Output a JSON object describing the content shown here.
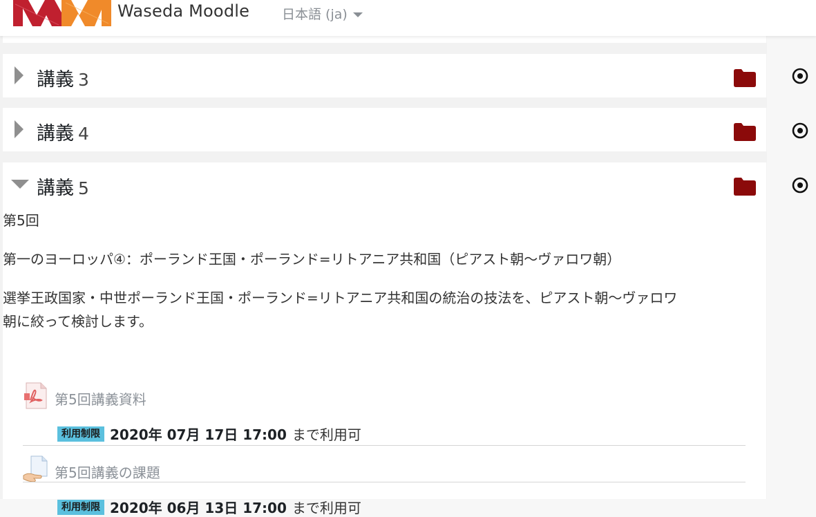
{
  "header": {
    "site_name": "Waseda Moodle",
    "language": "日本語 (ja)",
    "brand_colors": {
      "red": "#c0202f",
      "orange": "#f08a2a"
    }
  },
  "sections": [
    {
      "title": "講義",
      "number": "3",
      "expanded": false
    },
    {
      "title": "講義",
      "number": "4",
      "expanded": false
    },
    {
      "title": "講義",
      "number": "5",
      "expanded": true
    }
  ],
  "section5": {
    "summary": [
      "第5回",
      "第一のヨーロッパ④：ポーランド王国・ポーランド=リトアニア共和国（ピアスト朝〜ヴァロワ朝）",
      "選挙王政国家・中世ポーランド王国・ポーランド=リトアニア共和国の統治の技法を、ピアスト朝〜ヴァロワ",
      "朝に絞って検討します。"
    ],
    "activities": [
      {
        "name": "第5回講義資料",
        "icon": "pdf-icon",
        "restriction_badge": "利用制限",
        "restriction_date": "2020年 07月 17日 17:00",
        "restriction_suffix": "まで利用可"
      },
      {
        "name": "第5回講義の課題",
        "icon": "assignment-icon",
        "restriction_badge": "利用制限",
        "restriction_date": "2020年 06月 13日 17:00",
        "restriction_suffix": "まで利用可"
      }
    ]
  },
  "colors": {
    "folder": "#8b0a0a",
    "badge": "#5bc0de",
    "link_muted": "#8b9198"
  }
}
